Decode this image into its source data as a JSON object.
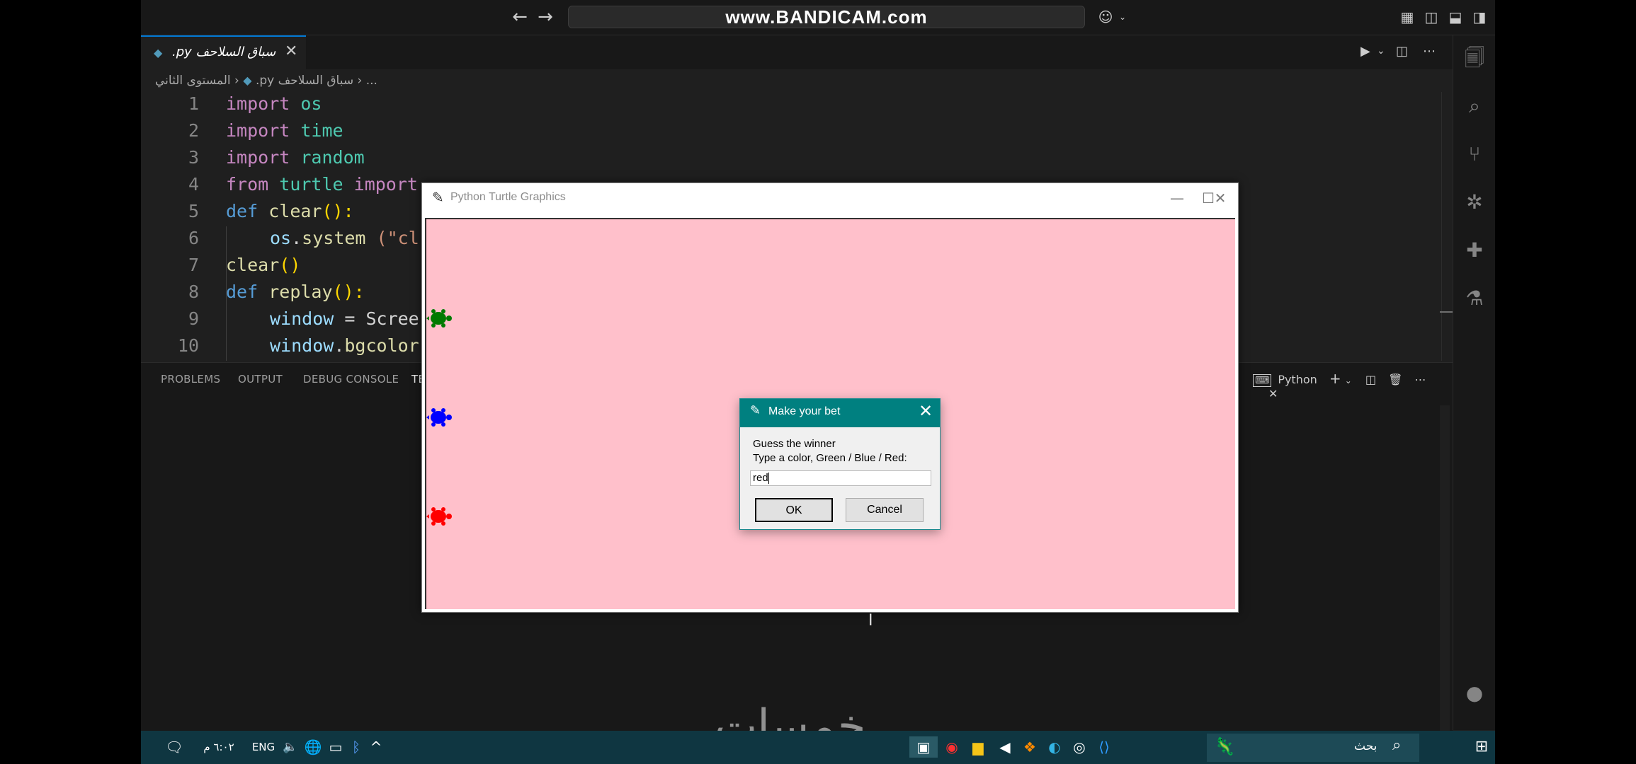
{
  "titlebar": {
    "command_center": "www.BANDICAM.com",
    "back_icon": "arrow-left",
    "forward_icon": "arrow-right"
  },
  "tab": {
    "label": ".py سباق السلاحف",
    "close": "✕"
  },
  "breadcrumb": {
    "folder": "المستوى الثاني",
    "file": ".py سباق السلاحف",
    "more": "..."
  },
  "editor": {
    "lines": [
      {
        "n": "1"
      },
      {
        "n": "2"
      },
      {
        "n": "3"
      },
      {
        "n": "4"
      },
      {
        "n": "5"
      },
      {
        "n": "6"
      },
      {
        "n": "7"
      },
      {
        "n": "8"
      },
      {
        "n": "9"
      },
      {
        "n": "10"
      }
    ],
    "code": {
      "l1_kw": "import",
      "l1_mod": "os",
      "l2_kw": "import",
      "l2_mod": "time",
      "l3_kw": "import",
      "l3_mod": "random",
      "l4_kw": "from",
      "l4_mod": "turtle",
      "l4_kw2": "import",
      "l5_kw": "def",
      "l5_fn": "clear",
      "l5_rest": "():",
      "l6_var": "os",
      "l6_fn": "system",
      "l6_str": " (\"cl",
      "l7_fn": "clear",
      "l7_rest": "()",
      "l8_kw": "def",
      "l8_fn": "replay",
      "l8_rest": "():",
      "l9_var": "window",
      "l9_rest": " = Scree",
      "l10_var": "window",
      "l10_fn": "bgcolor"
    }
  },
  "panel": {
    "tabs": [
      "PROBLEMS",
      "OUTPUT",
      "DEBUG CONSOLE",
      "TE"
    ],
    "terminal_name": "Python"
  },
  "turtle_window": {
    "title": "Python Turtle Graphics",
    "canvas_color": "#ffc0cb",
    "turtles": [
      {
        "color": "green"
      },
      {
        "color": "blue"
      },
      {
        "color": "red"
      }
    ]
  },
  "dialog": {
    "title": "Make your bet",
    "line1": "Guess the winner",
    "line2": "Type a color, Green / Blue / Red:",
    "input_value": "red",
    "ok_label": "OK",
    "cancel_label": "Cancel"
  },
  "taskbar": {
    "time": "٦:٠٢ م",
    "language": "ENG",
    "search_text": "بحث"
  },
  "watermark": "خمسات",
  "colors": {
    "accent": "#0078d4",
    "dialog_title": "#008080",
    "taskbar": "#0f3641"
  }
}
